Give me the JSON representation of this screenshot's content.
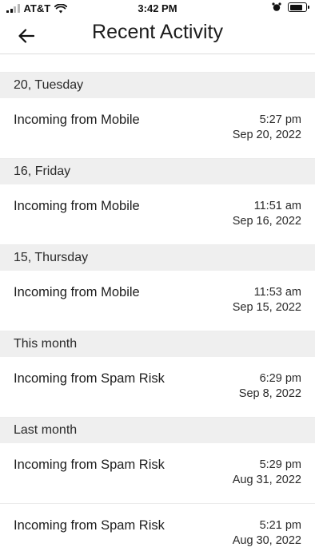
{
  "status_bar": {
    "carrier": "AT&T",
    "time": "3:42 PM",
    "battery_level": 0.85,
    "signal_bars": 2,
    "icons": [
      "signal-icon",
      "wifi-icon",
      "alarm-icon",
      "battery-icon"
    ]
  },
  "header": {
    "title": "Recent Activity",
    "back_icon": "back-arrow-icon"
  },
  "sections": [
    {
      "label": "20, Tuesday",
      "items": [
        {
          "title": "Incoming from Mobile",
          "time": "5:27 pm",
          "date": "Sep 20, 2022"
        }
      ]
    },
    {
      "label": "16, Friday",
      "items": [
        {
          "title": "Incoming from Mobile",
          "time": "11:51 am",
          "date": "Sep 16, 2022"
        }
      ]
    },
    {
      "label": "15, Thursday",
      "items": [
        {
          "title": "Incoming from Mobile",
          "time": "11:53 am",
          "date": "Sep 15, 2022"
        }
      ]
    },
    {
      "label": "This month",
      "items": [
        {
          "title": "Incoming from Spam Risk",
          "time": "6:29 pm",
          "date": "Sep 8, 2022"
        }
      ]
    },
    {
      "label": "Last month",
      "items": [
        {
          "title": "Incoming from Spam Risk",
          "time": "5:29 pm",
          "date": "Aug 31, 2022"
        },
        {
          "title": "Incoming from Spam Risk",
          "time": "5:21 pm",
          "date": "Aug 30, 2022"
        }
      ]
    }
  ],
  "colors": {
    "section_background": "#efefef",
    "divider": "#ececec",
    "text_primary": "#1d1d1d"
  }
}
